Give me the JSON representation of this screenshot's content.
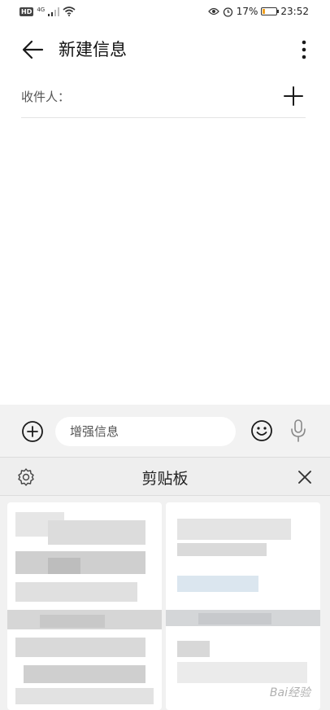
{
  "status_bar": {
    "hd_badge": "HD",
    "network": "4G",
    "battery": "17%",
    "battery_level": 0.17,
    "time": "23:52"
  },
  "header": {
    "title": "新建信息"
  },
  "recipient": {
    "label": "收件人："
  },
  "compose": {
    "placeholder": "增强信息"
  },
  "clipboard": {
    "title": "剪贴板"
  },
  "watermark": "Bai经验"
}
